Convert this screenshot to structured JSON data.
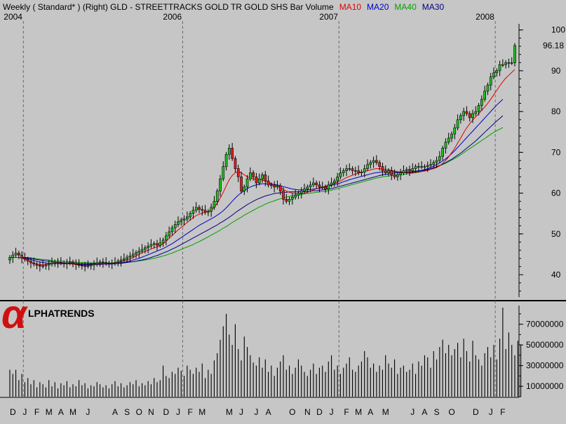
{
  "header": {
    "parts": [
      {
        "text": "Weekly ( Standard* )  (Right)  GLD - STREETTRACKS GOLD TR GOLD SHS  Bar  Volume",
        "color": "#000000"
      },
      {
        "text": "MA10",
        "color": "#e00000"
      },
      {
        "text": "MA20",
        "color": "#0000c8"
      },
      {
        "text": "MA40",
        "color": "#00a000"
      },
      {
        "text": "MA30",
        "color": "#000080"
      }
    ]
  },
  "logo": {
    "text": "LPHATRENDS",
    "glyph": "α"
  },
  "colors": {
    "background": "#c6c6c6",
    "up_candle": "#20c020",
    "down_candle": "#e02020",
    "ma10": "#e00000",
    "ma20": "#0000c8",
    "ma30": "#000080",
    "ma40": "#00a000",
    "volume": "#000000"
  },
  "chart_data": {
    "type": "candlestick",
    "title": "Weekly ( Standard* ) (Right) GLD - STREETTRACKS GOLD TR GOLD SHS Bar Volume",
    "price_axis": {
      "ticks": [
        40,
        50,
        60,
        70,
        80,
        90,
        100
      ],
      "ylim": [
        34.5,
        101.5
      ],
      "last_price_label": "96.18"
    },
    "volume_axis": {
      "ticks": [
        10000000,
        30000000,
        50000000,
        70000000
      ],
      "tick_labels": [
        "10000000",
        "30000000",
        "50000000",
        "70000000"
      ],
      "ylim": [
        0,
        88000000
      ]
    },
    "year_labels": [
      {
        "label": "2004",
        "week": 5
      },
      {
        "label": "2006",
        "week": 58
      },
      {
        "label": "2007",
        "week": 110
      },
      {
        "label": "2008",
        "week": 162
      }
    ],
    "month_labels": [
      {
        "label": "D",
        "week": 1
      },
      {
        "label": "J",
        "week": 5
      },
      {
        "label": "F",
        "week": 9
      },
      {
        "label": "M",
        "week": 13
      },
      {
        "label": "A",
        "week": 17
      },
      {
        "label": "M",
        "week": 21
      },
      {
        "label": "J",
        "week": 26
      },
      {
        "label": "A",
        "week": 35
      },
      {
        "label": "S",
        "week": 39
      },
      {
        "label": "O",
        "week": 43
      },
      {
        "label": "N",
        "week": 47
      },
      {
        "label": "D",
        "week": 52
      },
      {
        "label": "J",
        "week": 56
      },
      {
        "label": "F",
        "week": 60
      },
      {
        "label": "M",
        "week": 64
      },
      {
        "label": "M",
        "week": 73
      },
      {
        "label": "J",
        "week": 77
      },
      {
        "label": "J",
        "week": 82
      },
      {
        "label": "A",
        "week": 86
      },
      {
        "label": "O",
        "week": 94
      },
      {
        "label": "N",
        "week": 99
      },
      {
        "label": "D",
        "week": 103
      },
      {
        "label": "J",
        "week": 107
      },
      {
        "label": "F",
        "week": 112
      },
      {
        "label": "M",
        "week": 116
      },
      {
        "label": "A",
        "week": 120
      },
      {
        "label": "M",
        "week": 125
      },
      {
        "label": "J",
        "week": 134
      },
      {
        "label": "A",
        "week": 138
      },
      {
        "label": "S",
        "week": 142
      },
      {
        "label": "O",
        "week": 147
      },
      {
        "label": "D",
        "week": 155
      },
      {
        "label": "J",
        "week": 160
      },
      {
        "label": "F",
        "week": 164
      }
    ],
    "weeks": 169,
    "close": [
      44.2,
      44.8,
      45.3,
      44.8,
      44.1,
      43.8,
      43.3,
      42.9,
      42.6,
      42.3,
      42.1,
      42.2,
      42.4,
      42.6,
      42.9,
      43.1,
      43.0,
      42.9,
      42.7,
      42.9,
      43.1,
      42.8,
      42.5,
      42.3,
      42.2,
      42.1,
      42.2,
      42.4,
      42.6,
      42.9,
      43.1,
      43.0,
      42.8,
      42.7,
      42.8,
      43.0,
      43.3,
      43.6,
      43.9,
      44.3,
      44.6,
      45.0,
      45.4,
      45.8,
      46.2,
      46.6,
      47.0,
      47.4,
      47.6,
      47.2,
      47.8,
      48.5,
      49.5,
      50.5,
      51.5,
      52.3,
      53.0,
      53.4,
      53.6,
      54.2,
      55.0,
      55.8,
      56.5,
      56.0,
      55.8,
      55.3,
      55.5,
      56.5,
      58.0,
      60.5,
      63.5,
      66.5,
      69.5,
      71.0,
      68.5,
      66.0,
      64.0,
      60.5,
      61.5,
      63.5,
      65.0,
      64.0,
      62.5,
      63.5,
      64.5,
      63.0,
      62.0,
      62.0,
      61.5,
      61.8,
      60.5,
      58.5,
      58.0,
      58.5,
      59.0,
      59.5,
      60.0,
      60.5,
      61.0,
      61.5,
      62.0,
      62.5,
      62.0,
      61.5,
      61.5,
      61.0,
      62.0,
      62.5,
      63.0,
      64.0,
      65.0,
      65.5,
      66.0,
      66.0,
      65.5,
      65.5,
      65.0,
      65.2,
      66.0,
      67.0,
      67.5,
      68.0,
      67.5,
      66.5,
      65.5,
      65.0,
      65.5,
      64.5,
      64.0,
      64.5,
      65.0,
      65.5,
      65.8,
      65.5,
      66.0,
      66.5,
      66.5,
      66.5,
      66.5,
      66.8,
      67.0,
      67.5,
      68.0,
      69.0,
      71.0,
      72.5,
      73.5,
      74.5,
      76.0,
      78.0,
      79.0,
      80.0,
      79.5,
      78.5,
      79.5,
      80.0,
      81.5,
      83.0,
      85.0,
      86.5,
      88.5,
      89.5,
      90.0,
      91.5,
      91.5,
      92.0,
      92.0,
      92.0,
      96.18
    ],
    "ma10": [
      44.2,
      44.2,
      44.2,
      44.2,
      44.1,
      43.8,
      43.5,
      43.1,
      42.8,
      42.6,
      42.5,
      42.4,
      42.5,
      42.6,
      42.7,
      42.8,
      42.8,
      42.8,
      42.7,
      42.7,
      42.7,
      42.6,
      42.5,
      42.4,
      42.4,
      42.3,
      42.3,
      42.4,
      42.5,
      42.6,
      42.7,
      42.7,
      42.7,
      42.8,
      42.8,
      42.9,
      43.0,
      43.2,
      43.4,
      43.6,
      43.9,
      44.2,
      44.6,
      45.0,
      45.4,
      45.7,
      46.0,
      46.3,
      46.6,
      46.8,
      47.1,
      47.6,
      48.2,
      48.9,
      49.6,
      50.3,
      51.0,
      51.6,
      52.2,
      52.8,
      53.4,
      54.0,
      54.5,
      54.8,
      55.1,
      55.3,
      55.5,
      55.8,
      56.5,
      57.5,
      58.8,
      60.2,
      61.8,
      63.3,
      64.3,
      65.0,
      65.3,
      65.0,
      64.5,
      64.0,
      63.7,
      63.5,
      63.3,
      63.3,
      63.2,
      63.0,
      62.7,
      62.4,
      62.0,
      61.7,
      61.3,
      60.9,
      60.5,
      60.2,
      60.0,
      59.9,
      59.9,
      59.9,
      60.0,
      60.2,
      60.5,
      60.8,
      61.1,
      61.3,
      61.5,
      61.7,
      61.9,
      62.1,
      62.4,
      62.7,
      63.0,
      63.4,
      63.8,
      64.1,
      64.4,
      64.7,
      64.9,
      65.1,
      65.3,
      65.5,
      65.7,
      65.9,
      66.0,
      66.0,
      65.9,
      65.8,
      65.7,
      65.6,
      65.4,
      65.3,
      65.2,
      65.1,
      65.0,
      65.0,
      65.0,
      65.1,
      65.2,
      65.3,
      65.4,
      65.6,
      65.8,
      66.0,
      66.3,
      66.7,
      67.3,
      68.0,
      68.9,
      69.9,
      71.0,
      72.3,
      73.5,
      74.8,
      76.0,
      77.0,
      77.9,
      78.7,
      79.5,
      80.3,
      81.1,
      82.0,
      83.0,
      84.1,
      85.2,
      86.3,
      87.3,
      88.2,
      88.9,
      89.6,
      90.3
    ],
    "ma20": [
      44.2,
      44.2,
      44.2,
      44.2,
      44.2,
      44.1,
      43.9,
      43.7,
      43.5,
      43.3,
      43.1,
      43.0,
      42.9,
      42.8,
      42.7,
      42.7,
      42.7,
      42.7,
      42.7,
      42.7,
      42.7,
      42.6,
      42.6,
      42.6,
      42.6,
      42.5,
      42.5,
      42.5,
      42.5,
      42.5,
      42.5,
      42.6,
      42.6,
      42.6,
      42.6,
      42.7,
      42.8,
      42.9,
      43.0,
      43.2,
      43.4,
      43.6,
      43.8,
      44.0,
      44.3,
      44.6,
      44.9,
      45.2,
      45.5,
      45.8,
      46.1,
      46.4,
      46.8,
      47.2,
      47.6,
      48.1,
      48.6,
      49.1,
      49.6,
      50.1,
      50.6,
      51.1,
      51.6,
      52.1,
      52.5,
      52.9,
      53.3,
      53.7,
      54.1,
      54.6,
      55.1,
      55.7,
      56.4,
      57.2,
      58.0,
      58.8,
      59.5,
      60.1,
      60.6,
      61.1,
      61.5,
      61.8,
      62.0,
      62.2,
      62.3,
      62.3,
      62.3,
      62.2,
      62.1,
      62.0,
      61.8,
      61.6,
      61.4,
      61.2,
      61.0,
      60.9,
      60.8,
      60.8,
      60.8,
      60.8,
      60.9,
      61.0,
      61.1,
      61.2,
      61.3,
      61.5,
      61.7,
      61.9,
      62.1,
      62.3,
      62.5,
      62.8,
      63.0,
      63.3,
      63.5,
      63.7,
      63.9,
      64.1,
      64.3,
      64.5,
      64.7,
      64.9,
      65.0,
      65.1,
      65.2,
      65.2,
      65.2,
      65.2,
      65.2,
      65.2,
      65.2,
      65.2,
      65.2,
      65.2,
      65.3,
      65.4,
      65.5,
      65.6,
      65.8,
      66.0,
      66.3,
      66.6,
      67.0,
      67.4,
      67.9,
      68.4,
      69.0,
      69.7,
      70.4,
      71.2,
      72.0,
      72.8,
      73.6,
      74.4,
      75.2,
      76.0,
      76.8,
      77.6,
      78.4,
      79.2,
      80.0,
      80.8,
      81.6,
      82.3,
      83.0
    ],
    "ma30": [
      44.2,
      44.2,
      44.2,
      44.2,
      44.2,
      44.2,
      44.1,
      44.0,
      43.9,
      43.7,
      43.6,
      43.5,
      43.4,
      43.3,
      43.2,
      43.1,
      43.0,
      43.0,
      42.9,
      42.9,
      42.8,
      42.8,
      42.8,
      42.7,
      42.7,
      42.7,
      42.7,
      42.7,
      42.7,
      42.7,
      42.7,
      42.7,
      42.7,
      42.7,
      42.7,
      42.7,
      42.8,
      42.8,
      42.9,
      43.0,
      43.1,
      43.2,
      43.3,
      43.5,
      43.6,
      43.8,
      44.0,
      44.2,
      44.5,
      44.7,
      45.0,
      45.3,
      45.6,
      45.9,
      46.3,
      46.6,
      47.0,
      47.4,
      47.8,
      48.2,
      48.6,
      49.0,
      49.4,
      49.8,
      50.2,
      50.6,
      51.0,
      51.4,
      51.8,
      52.2,
      52.7,
      53.1,
      53.6,
      54.1,
      54.6,
      55.2,
      55.7,
      56.2,
      56.7,
      57.2,
      57.6,
      58.0,
      58.4,
      58.7,
      59.0,
      59.3,
      59.5,
      59.7,
      59.9,
      60.0,
      60.1,
      60.2,
      60.2,
      60.3,
      60.3,
      60.3,
      60.3,
      60.4,
      60.4,
      60.4,
      60.5,
      60.6,
      60.6,
      60.7,
      60.8,
      60.9,
      61.0,
      61.1,
      61.3,
      61.5,
      61.7,
      61.9,
      62.1,
      62.3,
      62.5,
      62.7,
      62.9,
      63.1,
      63.3,
      63.5,
      63.7,
      63.9,
      64.1,
      64.3,
      64.5,
      64.6,
      64.7,
      64.8,
      64.9,
      65.0,
      65.0,
      65.0,
      65.1,
      65.1,
      65.2,
      65.3,
      65.4,
      65.5,
      65.6,
      65.8,
      66.0,
      66.2,
      66.5,
      66.8,
      67.1,
      67.5,
      67.9,
      68.3,
      68.8,
      69.3,
      69.8,
      70.4,
      71.0,
      71.6,
      72.2,
      72.8,
      73.5,
      74.2,
      74.9,
      75.6,
      76.3,
      77.0,
      77.7,
      78.3,
      79.0
    ],
    "ma40": [
      44.2,
      44.2,
      44.2,
      44.2,
      44.2,
      44.2,
      44.2,
      44.1,
      44.0,
      43.9,
      43.8,
      43.7,
      43.7,
      43.6,
      43.5,
      43.4,
      43.4,
      43.3,
      43.3,
      43.2,
      43.2,
      43.1,
      43.1,
      43.0,
      43.0,
      43.0,
      42.9,
      42.9,
      42.9,
      42.9,
      42.9,
      42.9,
      42.9,
      42.9,
      42.9,
      42.9,
      42.9,
      43.0,
      43.0,
      43.1,
      43.1,
      43.2,
      43.3,
      43.4,
      43.5,
      43.6,
      43.7,
      43.9,
      44.0,
      44.2,
      44.4,
      44.6,
      44.8,
      45.1,
      45.3,
      45.6,
      45.9,
      46.2,
      46.5,
      46.8,
      47.1,
      47.4,
      47.8,
      48.1,
      48.5,
      48.9,
      49.3,
      49.7,
      50.1,
      50.5,
      50.9,
      51.4,
      51.8,
      52.3,
      52.8,
      53.2,
      53.7,
      54.1,
      54.6,
      55.0,
      55.4,
      55.8,
      56.2,
      56.6,
      56.9,
      57.3,
      57.6,
      57.9,
      58.1,
      58.4,
      58.6,
      58.8,
      59.0,
      59.2,
      59.3,
      59.5,
      59.6,
      59.7,
      59.8,
      59.9,
      60.0,
      60.1,
      60.2,
      60.3,
      60.4,
      60.5,
      60.6,
      60.7,
      60.9,
      61.1,
      61.3,
      61.5,
      61.7,
      61.9,
      62.1,
      62.3,
      62.5,
      62.7,
      62.9,
      63.1,
      63.3,
      63.5,
      63.7,
      63.8,
      64.0,
      64.1,
      64.2,
      64.3,
      64.4,
      64.5,
      64.5,
      64.6,
      64.7,
      64.8,
      64.9,
      65.0,
      65.1,
      65.3,
      65.5,
      65.7,
      65.9,
      66.1,
      66.4,
      66.7,
      67.0,
      67.3,
      67.7,
      68.1,
      68.5,
      68.9,
      69.4,
      69.9,
      70.4,
      70.9,
      71.4,
      71.9,
      72.4,
      72.9,
      73.4,
      73.9,
      74.4,
      74.9,
      75.3,
      75.7,
      76.1
    ],
    "volume": [
      26000000,
      22000000,
      26000000,
      16000000,
      22000000,
      14000000,
      18000000,
      12000000,
      16000000,
      9000000,
      14000000,
      12000000,
      9000000,
      16000000,
      10000000,
      14000000,
      8000000,
      13000000,
      11000000,
      15000000,
      9000000,
      12000000,
      10000000,
      16000000,
      11000000,
      13000000,
      8000000,
      11000000,
      10000000,
      14000000,
      12000000,
      9000000,
      11000000,
      8000000,
      12000000,
      15000000,
      10000000,
      13000000,
      9000000,
      11000000,
      14000000,
      12000000,
      16000000,
      10000000,
      13000000,
      11000000,
      15000000,
      12000000,
      18000000,
      14000000,
      16000000,
      30000000,
      20000000,
      18000000,
      24000000,
      22000000,
      28000000,
      25000000,
      20000000,
      30000000,
      26000000,
      22000000,
      28000000,
      24000000,
      32000000,
      18000000,
      26000000,
      22000000,
      35000000,
      42000000,
      55000000,
      68000000,
      80000000,
      60000000,
      50000000,
      70000000,
      46000000,
      35000000,
      58000000,
      48000000,
      40000000,
      33000000,
      30000000,
      38000000,
      28000000,
      36000000,
      24000000,
      30000000,
      20000000,
      28000000,
      34000000,
      40000000,
      26000000,
      30000000,
      22000000,
      28000000,
      36000000,
      30000000,
      24000000,
      20000000,
      26000000,
      32000000,
      22000000,
      28000000,
      30000000,
      24000000,
      34000000,
      40000000,
      26000000,
      30000000,
      22000000,
      28000000,
      32000000,
      38000000,
      26000000,
      24000000,
      30000000,
      34000000,
      44000000,
      38000000,
      28000000,
      32000000,
      24000000,
      30000000,
      26000000,
      40000000,
      32000000,
      28000000,
      36000000,
      22000000,
      28000000,
      30000000,
      24000000,
      26000000,
      32000000,
      22000000,
      34000000,
      30000000,
      40000000,
      38000000,
      28000000,
      44000000,
      36000000,
      48000000,
      55000000,
      42000000,
      50000000,
      40000000,
      46000000,
      52000000,
      38000000,
      56000000,
      44000000,
      34000000,
      54000000,
      40000000,
      36000000,
      30000000,
      42000000,
      48000000,
      38000000,
      50000000,
      36000000,
      56000000,
      86000000,
      46000000,
      62000000,
      50000000,
      40000000,
      54000000,
      50000000
    ]
  }
}
